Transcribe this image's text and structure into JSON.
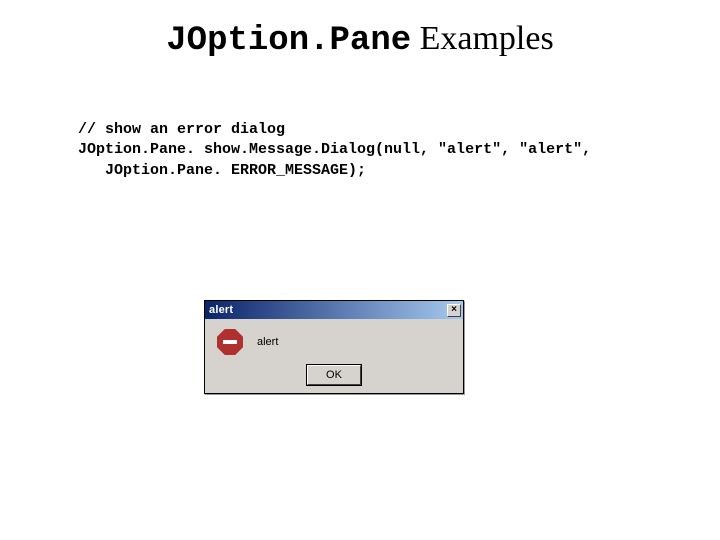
{
  "title": {
    "mono_part": "JOption.Pane",
    "plain_part": " Examples"
  },
  "code": {
    "line1": "// show an error dialog",
    "line2": "JOption.Pane. show.Message.Dialog(null, \"alert\", \"alert\",",
    "line3": "   JOption.Pane. ERROR_MESSAGE);"
  },
  "dialog": {
    "title": "alert",
    "close_glyph": "×",
    "message": "alert",
    "ok_label": "OK"
  }
}
